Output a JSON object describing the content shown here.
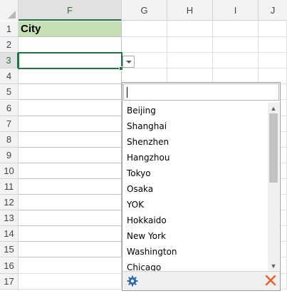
{
  "columns": [
    "F",
    "G",
    "H",
    "I",
    "J"
  ],
  "rows": [
    "1",
    "2",
    "3",
    "4",
    "5",
    "6",
    "7",
    "8",
    "9",
    "10",
    "11",
    "12",
    "13",
    "14",
    "15",
    "16",
    "17"
  ],
  "cells": {
    "F1": "City"
  },
  "dropdown": {
    "search_value": "",
    "items": [
      "Beijing",
      "Shanghai",
      "Shenzhen",
      "Hangzhou",
      "Tokyo",
      "Osaka",
      "YOK",
      "Hokkaido",
      "New York",
      "Washington",
      "Chicago"
    ]
  },
  "colors": {
    "header_fill": "#c6e0b4",
    "accent": "#217346",
    "close": "#e8612c",
    "gear": "#2e6ab1"
  },
  "icons": {
    "settings": "gear-icon",
    "close": "close-icon",
    "up": "chevron-up-icon",
    "down": "chevron-down-icon"
  }
}
